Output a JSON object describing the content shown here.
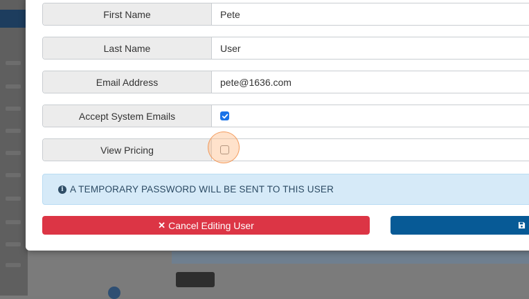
{
  "form": {
    "rows": [
      {
        "label": "First Name",
        "value": "Pete"
      },
      {
        "label": "Last Name",
        "value": "User"
      },
      {
        "label": "Email Address",
        "value": "pete@1636.com"
      },
      {
        "label": "Accept System Emails",
        "checked": true
      },
      {
        "label": "View Pricing",
        "checked": false
      }
    ]
  },
  "alert": {
    "icon": "info-circle-icon",
    "text": "A TEMPORARY PASSWORD WILL BE SENT TO THIS USER"
  },
  "actions": {
    "cancel_label": "Cancel Editing User",
    "cancel_icon": "close-icon",
    "save_icon": "floppy-disk-icon"
  },
  "colors": {
    "danger": "#dc3545",
    "primary": "#075a96",
    "info_bg": "#d6eaf8",
    "checkbox": "#1a73e8"
  }
}
